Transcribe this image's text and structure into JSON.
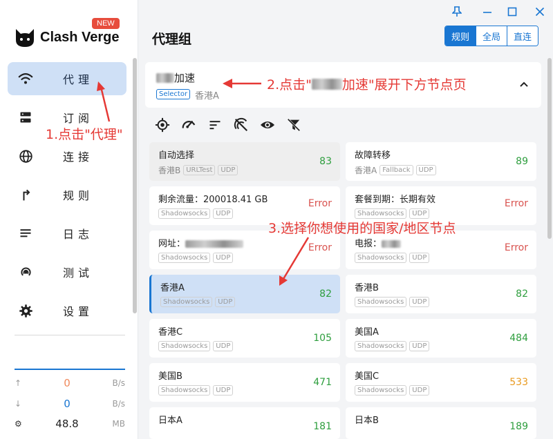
{
  "app": {
    "name": "Clash Verge",
    "badge": "NEW"
  },
  "sidebar": {
    "items": [
      {
        "label": "代理",
        "icon": "wifi-icon",
        "active": true
      },
      {
        "label": "订阅",
        "icon": "server-icon"
      },
      {
        "label": "连接",
        "icon": "globe-icon"
      },
      {
        "label": "规则",
        "icon": "route-icon"
      },
      {
        "label": "日志",
        "icon": "list-icon"
      },
      {
        "label": "测试",
        "icon": "broadcast-icon"
      },
      {
        "label": "设置",
        "icon": "gear-icon"
      }
    ],
    "traffic": {
      "up": {
        "value": "0",
        "unit": "B/s"
      },
      "down": {
        "value": "0",
        "unit": "B/s"
      },
      "memory": {
        "value": "48.8",
        "unit": "MB"
      }
    }
  },
  "header": {
    "title": "代理组",
    "modes": [
      {
        "label": "规则",
        "active": true
      },
      {
        "label": "全局"
      },
      {
        "label": "直连"
      }
    ]
  },
  "group": {
    "name_suffix": "加速",
    "type_tag": "Selector",
    "current": "香港A"
  },
  "toolbar": {
    "icons": [
      "locate-icon",
      "speed-test-icon",
      "sort-icon",
      "filter-off-icon",
      "eye-icon",
      "clear-filter-icon"
    ]
  },
  "proxies": [
    {
      "name": "自动选择",
      "sub": "香港B",
      "tags": [
        "URLTest",
        "UDP"
      ],
      "delay": "83",
      "delay_color": "green",
      "style": "gray"
    },
    {
      "name": "故障转移",
      "sub": "香港A",
      "tags": [
        "Fallback",
        "UDP"
      ],
      "delay": "89",
      "delay_color": "green"
    },
    {
      "name": "剩余流量：200018.41 GB",
      "sub": "",
      "tags": [
        "Shadowsocks",
        "UDP"
      ],
      "delay": "Error",
      "delay_color": "error"
    },
    {
      "name": "套餐到期：长期有效",
      "sub": "",
      "tags": [
        "Shadowsocks",
        "UDP"
      ],
      "delay": "Error",
      "delay_color": "error"
    },
    {
      "name": "网址：",
      "sub": "",
      "tags": [
        "Shadowsocks",
        "UDP"
      ],
      "delay": "Error",
      "delay_color": "error",
      "blur": true
    },
    {
      "name": "电报：",
      "sub": "",
      "tags": [
        "Shadowsocks",
        "UDP"
      ],
      "delay": "Error",
      "delay_color": "error",
      "blur": true
    },
    {
      "name": "香港A",
      "sub": "",
      "tags": [
        "Shadowsocks",
        "UDP"
      ],
      "delay": "82",
      "delay_color": "green",
      "style": "selected"
    },
    {
      "name": "香港B",
      "sub": "",
      "tags": [
        "Shadowsocks",
        "UDP"
      ],
      "delay": "82",
      "delay_color": "green"
    },
    {
      "name": "香港C",
      "sub": "",
      "tags": [
        "Shadowsocks",
        "UDP"
      ],
      "delay": "105",
      "delay_color": "green"
    },
    {
      "name": "美国A",
      "sub": "",
      "tags": [
        "Shadowsocks",
        "UDP"
      ],
      "delay": "484",
      "delay_color": "green"
    },
    {
      "name": "美国B",
      "sub": "",
      "tags": [
        "Shadowsocks",
        "UDP"
      ],
      "delay": "471",
      "delay_color": "green"
    },
    {
      "name": "美国C",
      "sub": "",
      "tags": [
        "Shadowsocks",
        "UDP"
      ],
      "delay": "533",
      "delay_color": "orange"
    },
    {
      "name": "日本A",
      "sub": "",
      "tags": [],
      "delay": "181",
      "delay_color": "green"
    },
    {
      "name": "日本B",
      "sub": "",
      "tags": [],
      "delay": "189",
      "delay_color": "green"
    }
  ],
  "annotations": {
    "step1": "1.点击\"代理\"",
    "step2_prefix": "2.点击\"",
    "step2_suffix": "加速\"展开下方节点页",
    "step3": "3.选择你想使用的国家/地区节点"
  },
  "colors": {
    "accent": "#1976d2",
    "active_bg": "#cfe0f6",
    "annotation": "#e53935",
    "delay_ok": "#2e9e3e",
    "delay_error": "#d9534f",
    "delay_warn": "#e99a1f"
  }
}
